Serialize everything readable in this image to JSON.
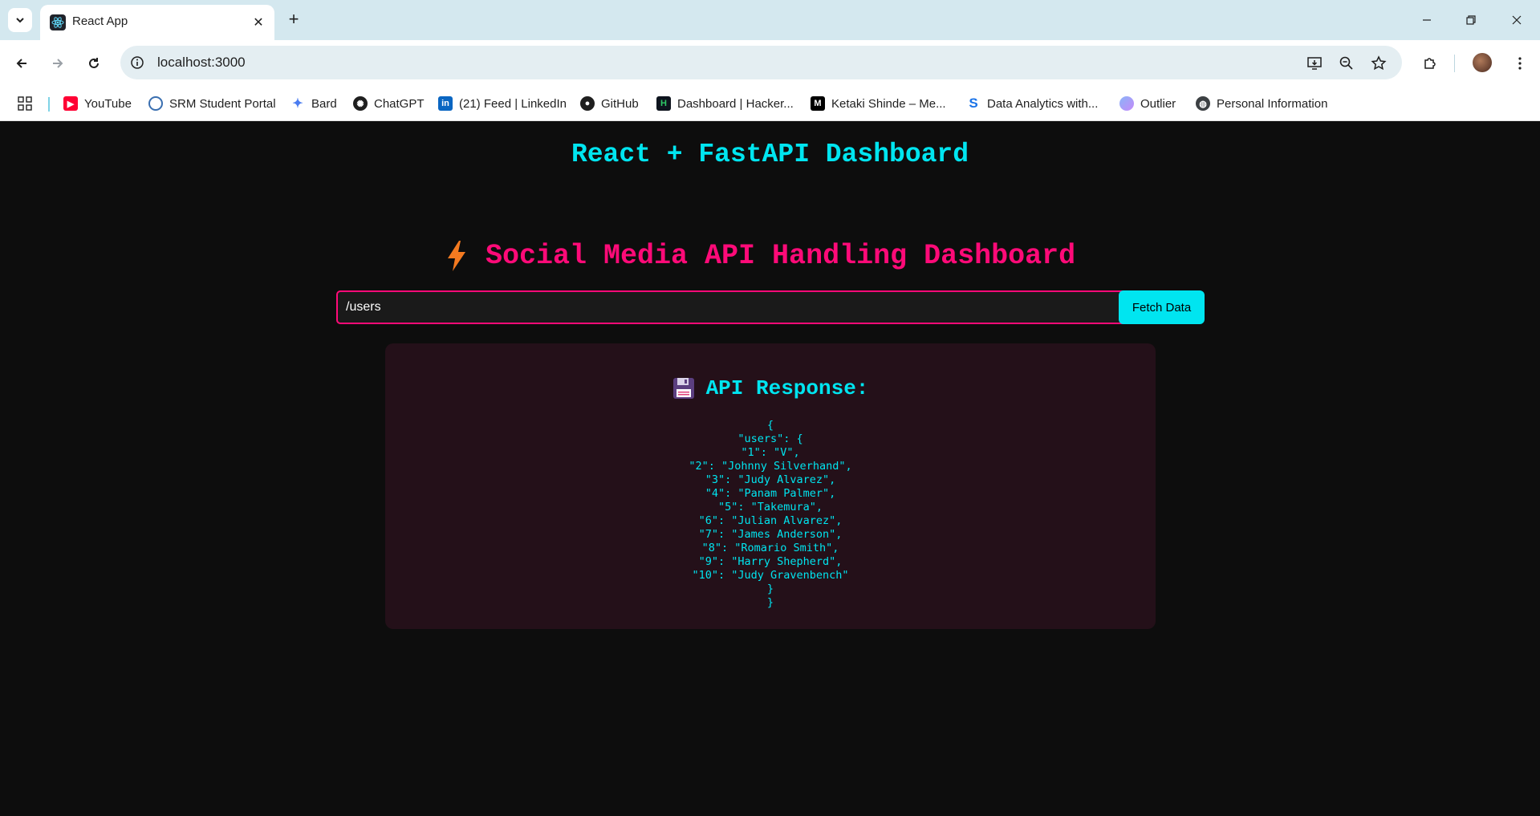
{
  "browser": {
    "tab": {
      "title": "React App"
    },
    "address": {
      "url": "localhost:3000"
    },
    "bookmarks": [
      {
        "label": "YouTube",
        "icon": "youtube-icon"
      },
      {
        "label": "SRM Student Portal",
        "icon": "srm-icon"
      },
      {
        "label": "Bard",
        "icon": "bard-icon"
      },
      {
        "label": "ChatGPT",
        "icon": "chatgpt-icon"
      },
      {
        "label": "(21) Feed | LinkedIn",
        "icon": "linkedin-icon"
      },
      {
        "label": "GitHub",
        "icon": "github-icon"
      },
      {
        "label": "Dashboard | Hacker...",
        "icon": "hackerrank-icon"
      },
      {
        "label": "Ketaki Shinde – Me...",
        "icon": "medium-icon"
      },
      {
        "label": "Data Analytics with...",
        "icon": "data-analytics-icon"
      },
      {
        "label": "Outlier",
        "icon": "outlier-icon"
      },
      {
        "label": "Personal Information",
        "icon": "globe-icon"
      }
    ]
  },
  "app": {
    "title": "React + FastAPI Dashboard",
    "dashboard_title": "Social Media API Handling Dashboard",
    "endpoint_value": "/users",
    "fetch_button_label": "Fetch Data",
    "response_heading": "API Response:",
    "response_body": "{\n\"users\": {\n\"1\": \"V\",\n\"2\": \"Johnny Silverhand\",\n\"3\": \"Judy Alvarez\",\n\"4\": \"Panam Palmer\",\n\"5\": \"Takemura\",\n\"6\": \"Julian Alvarez\",\n\"7\": \"James Anderson\",\n\"8\": \"Romario Smith\",\n\"9\": \"Harry Shepherd\",\n\"10\": \"Judy Gravenbench\"\n}\n}"
  },
  "colors": {
    "accent_cyan": "#00e5f0",
    "accent_pink": "#ff0a78",
    "page_background": "#0d0d0d",
    "card_background": "#241019"
  }
}
